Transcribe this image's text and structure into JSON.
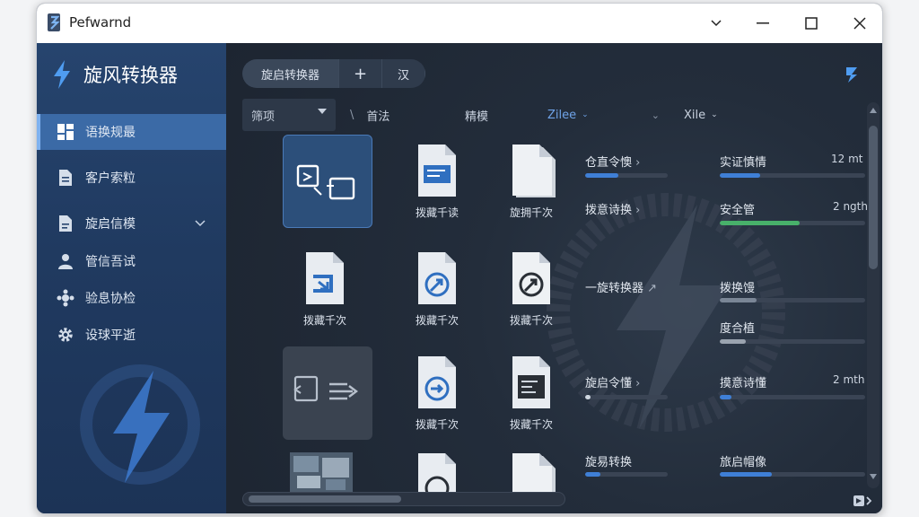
{
  "window": {
    "title": "Pefwarnd",
    "buttons": [
      "chevron-down",
      "minimize",
      "maximize",
      "close"
    ]
  },
  "sidebar": {
    "brand": "旋风转换器",
    "items": [
      {
        "label": "语换规最",
        "icon": "dashboard-icon",
        "active": true
      },
      {
        "label": "客户索粒",
        "icon": "document-icon",
        "active": false
      },
      {
        "label": "旋启信模",
        "icon": "file-icon",
        "active": false,
        "expandable": true
      },
      {
        "label": "管信吾试",
        "icon": "user-icon",
        "active": false
      },
      {
        "label": "验息协检",
        "icon": "network-icon",
        "active": false
      },
      {
        "label": "设球平逝",
        "icon": "gear-icon",
        "active": false
      }
    ]
  },
  "toolbar": {
    "tab_main": "旋启转换器",
    "tab_plus": "+",
    "tab_grid": "汉"
  },
  "columns": {
    "filter": "筛项",
    "col2": "首法",
    "col3": "精模",
    "col4": "Zilee",
    "col5": "Xile"
  },
  "files": [
    {
      "label": "",
      "kind": "convert-selected"
    },
    {
      "label": "拨藏千读",
      "kind": "doc-blue"
    },
    {
      "label": "旋拥千次",
      "kind": "doc-plain"
    },
    {
      "label": "拨藏千次",
      "kind": "doc-arrow"
    },
    {
      "label": "拨藏千次",
      "kind": "doc-circle"
    },
    {
      "label": "拨藏千次",
      "kind": "doc-circle-dark"
    },
    {
      "label": "",
      "kind": "convert-dim"
    },
    {
      "label": "拨藏千次",
      "kind": "doc-circle"
    },
    {
      "label": "拨藏千次",
      "kind": "doc-terminal"
    },
    {
      "label": "",
      "kind": "image-thumb"
    },
    {
      "label": "",
      "kind": "doc-circle"
    },
    {
      "label": "",
      "kind": "doc-plain"
    }
  ],
  "stats_left": [
    {
      "label": "仓直令懊",
      "arrow": "›",
      "value_pct": 40,
      "color": "#3f7fd6"
    },
    {
      "label": "拨意诗换",
      "arrow": "›",
      "value_pct": 0,
      "color": "#3f7fd6"
    },
    {
      "label": "一旋转换器",
      "arrow": "↗",
      "value_pct": 0,
      "color": "#3f7fd6"
    },
    {
      "label": "旋启令懂",
      "arrow": "›",
      "value_pct": 6,
      "color": "#cfd6df"
    },
    {
      "label": "旋易转换",
      "arrow": "",
      "value_pct": 18,
      "color": "#3f7fd6"
    }
  ],
  "stats_right": [
    {
      "label": "实证慎情",
      "value": "12 mt",
      "value_pct": 28,
      "color": "#3f7fd6"
    },
    {
      "label": "安全管",
      "value": "2 ngth",
      "value_pct": 55,
      "color": "#48b06a"
    },
    {
      "label": "拨换馒",
      "value": "",
      "value_pct": 25,
      "color": "#7a8696"
    },
    {
      "label": "度合植",
      "value": "",
      "value_pct": 18,
      "color": "#9aa3af"
    },
    {
      "label": "摸意诗懂",
      "value": "2 mth",
      "value_pct": 8,
      "color": "#3f7fd6"
    },
    {
      "label": "旅启帽像",
      "value": "",
      "value_pct": 36,
      "color": "#3f7fd6"
    }
  ]
}
